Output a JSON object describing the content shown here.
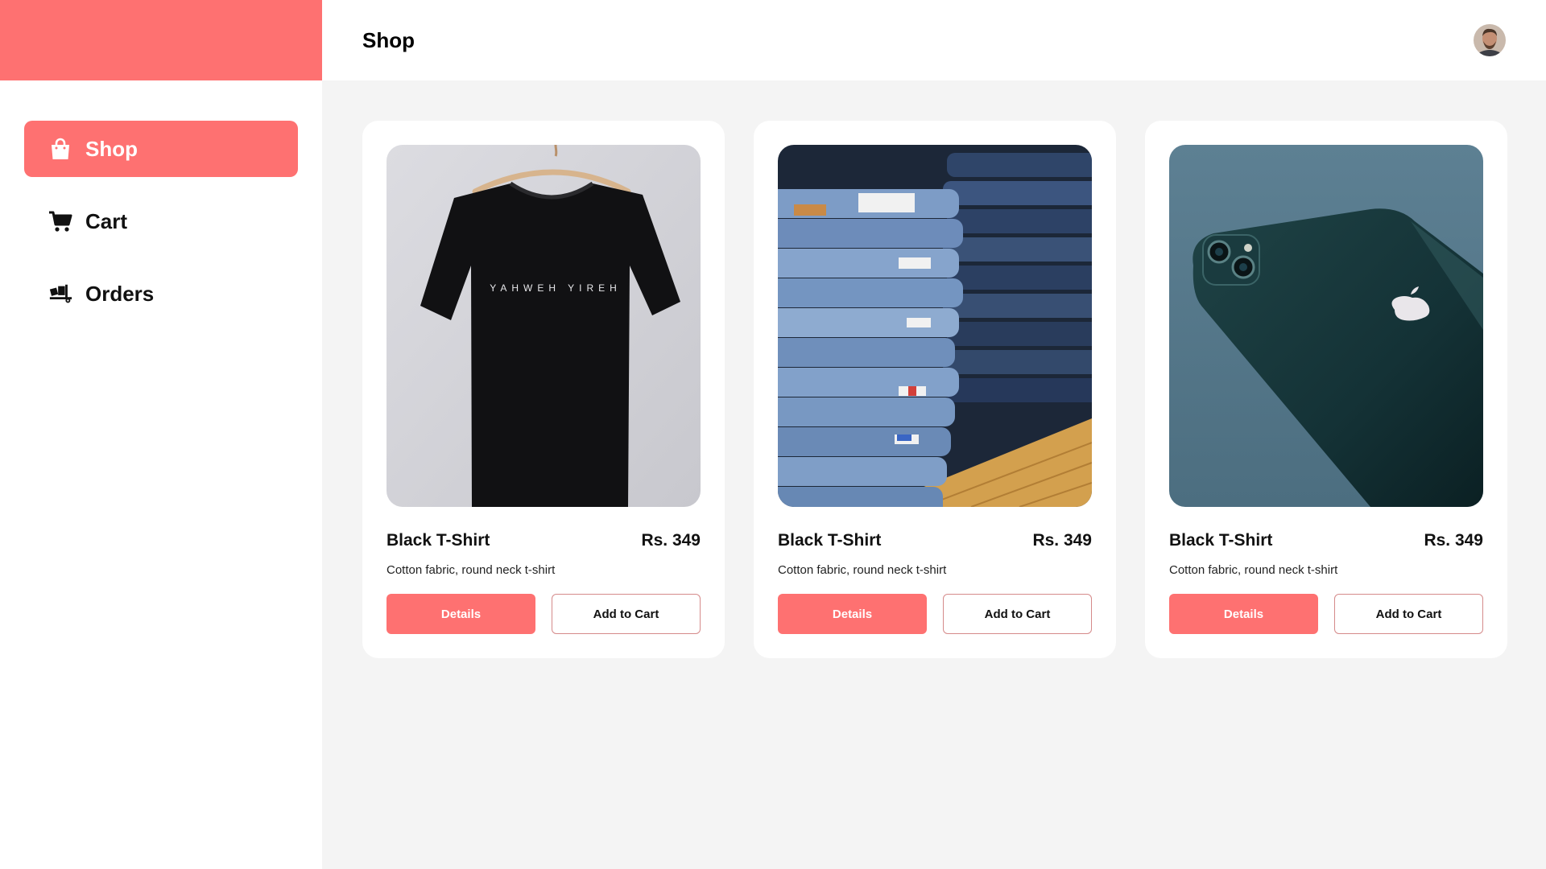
{
  "theme": {
    "accent": "#fe7171",
    "background": "#f4f4f4",
    "surface": "#ffffff"
  },
  "sidebar": {
    "items": [
      {
        "label": "Shop",
        "icon": "shopping-bag-icon",
        "active": true
      },
      {
        "label": "Cart",
        "icon": "shopping-cart-icon",
        "active": false
      },
      {
        "label": "Orders",
        "icon": "truck-loading-icon",
        "active": false
      }
    ]
  },
  "header": {
    "title": "Shop",
    "avatar": "user-avatar"
  },
  "products": [
    {
      "name": "Black T-Shirt",
      "price": "Rs. 349",
      "description": "Cotton fabric, round neck t-shirt",
      "details_label": "Details",
      "add_label": "Add to Cart",
      "image": "black-tshirt-photo",
      "shirt_print": "YAHWEH YIREH"
    },
    {
      "name": "Black T-Shirt",
      "price": "Rs. 349",
      "description": "Cotton fabric, round neck t-shirt",
      "details_label": "Details",
      "add_label": "Add to Cart",
      "image": "stacked-jeans-photo"
    },
    {
      "name": "Black T-Shirt",
      "price": "Rs. 349",
      "description": "Cotton fabric, round neck t-shirt",
      "details_label": "Details",
      "add_label": "Add to Cart",
      "image": "smartphone-photo"
    }
  ]
}
